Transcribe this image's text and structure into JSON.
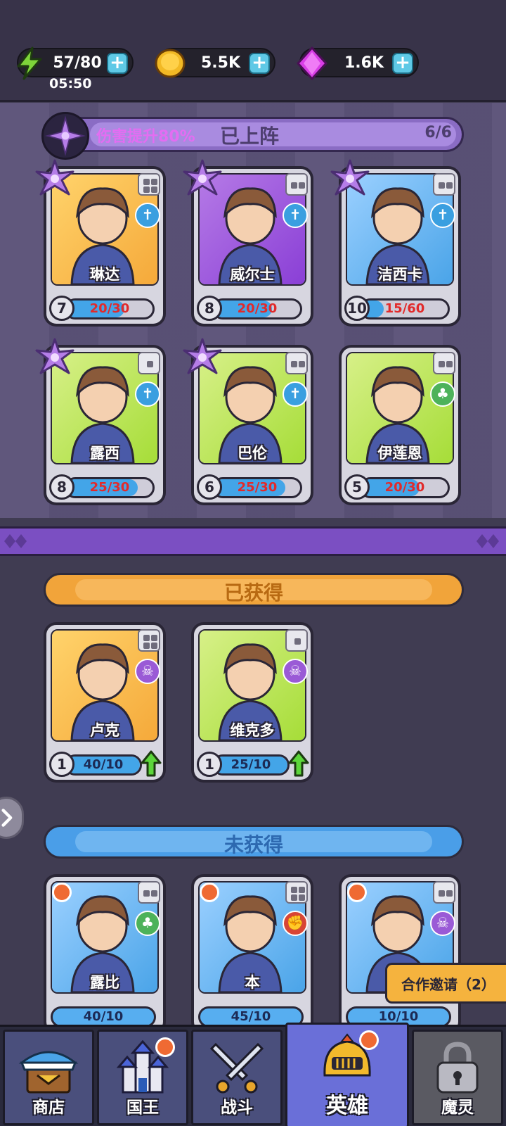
{
  "resources": {
    "energy": {
      "value": "57/80",
      "timer": "05:50",
      "icon": "lightning-icon"
    },
    "gold": {
      "value": "5.5K",
      "icon": "coin-icon"
    },
    "gems": {
      "value": "1.6K",
      "icon": "gem-icon"
    },
    "plus_label": "+"
  },
  "deployed": {
    "bonus": "伤害提升80%",
    "title": "已上阵",
    "count": "6/6",
    "heroes": [
      {
        "name": "琳达",
        "level": "7",
        "shards": "20/30",
        "progress": 0.67,
        "class_icon": "cross-icon",
        "class_color": "blue"
      },
      {
        "name": "威尔士",
        "level": "8",
        "shards": "20/30",
        "progress": 0.67,
        "class_icon": "cross-icon",
        "class_color": "blue"
      },
      {
        "name": "洁西卡",
        "level": "10",
        "shards": "15/60",
        "progress": 0.25,
        "class_icon": "cross-icon",
        "class_color": "blue"
      },
      {
        "name": "露西",
        "level": "8",
        "shards": "25/30",
        "progress": 0.83,
        "class_icon": "cross-icon",
        "class_color": "blue"
      },
      {
        "name": "巴伦",
        "level": "6",
        "shards": "25/30",
        "progress": 0.83,
        "class_icon": "cross-icon",
        "class_color": "blue"
      },
      {
        "name": "伊莲恩",
        "level": "5",
        "shards": "20/30",
        "progress": 0.67,
        "class_icon": "leaf-icon",
        "class_color": "green"
      }
    ]
  },
  "owned": {
    "title": "已获得",
    "heroes": [
      {
        "name": "卢克",
        "level": "1",
        "shards": "40/10",
        "progress": 1.0,
        "class_icon": "skull-icon",
        "class_color": "purple"
      },
      {
        "name": "维克多",
        "level": "1",
        "shards": "25/10",
        "progress": 1.0,
        "class_icon": "skull-icon",
        "class_color": "purple"
      }
    ]
  },
  "unowned": {
    "title": "未获得",
    "heroes": [
      {
        "name": "露比",
        "shards": "40/10",
        "class_icon": "leaf-icon",
        "class_color": "green"
      },
      {
        "name": "本",
        "shards": "45/10",
        "class_icon": "fist-icon",
        "class_color": "red"
      },
      {
        "shards": "10/10",
        "class_icon": "skull-icon",
        "class_color": "purple"
      }
    ]
  },
  "coop_invite": "合作邀请（2）",
  "nav": {
    "shop": "商店",
    "king": "国王",
    "battle": "战斗",
    "heroes": "英雄",
    "spirit": "魔灵"
  }
}
